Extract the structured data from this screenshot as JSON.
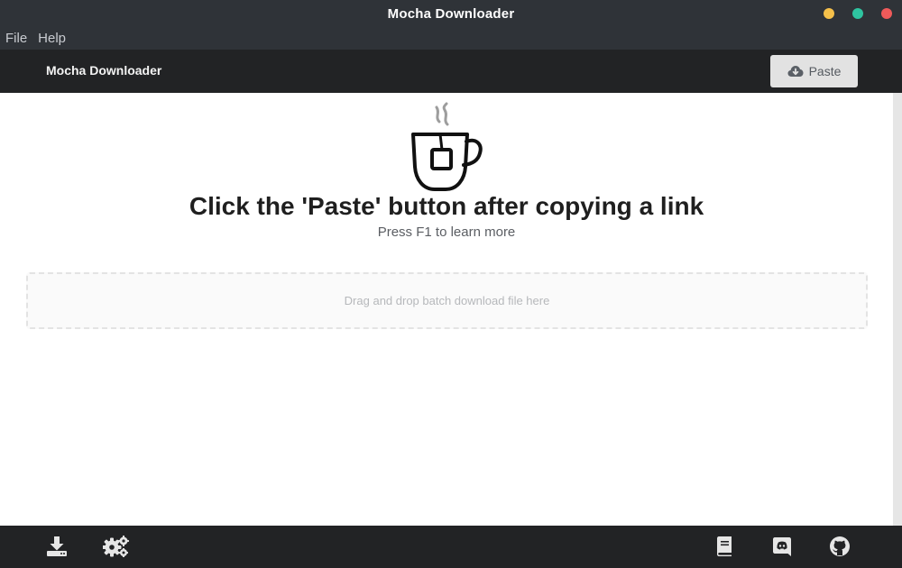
{
  "window": {
    "title": "Mocha Downloader",
    "controls": [
      "minimize",
      "maximize",
      "close"
    ]
  },
  "menu": {
    "items": [
      "File",
      "Help"
    ]
  },
  "header": {
    "app_name": "Mocha Downloader",
    "paste_label": "Paste",
    "paste_icon": "cloud-download-icon"
  },
  "main": {
    "illustration": "coffee-mug-icon",
    "headline": "Click the 'Paste' button after copying a link",
    "subline": "Press F1 to learn more",
    "dropzone_text": "Drag and drop batch download file here"
  },
  "footer": {
    "left_icons": [
      "downloads-icon",
      "settings-icon"
    ],
    "right_icons": [
      "docs-icon",
      "discord-icon",
      "github-icon"
    ]
  },
  "colors": {
    "titlebar": "#2f3338",
    "header": "#222325",
    "paste_button": "#e2e2e2",
    "minimize": "#f5c04a",
    "maximize": "#2ec4a0",
    "close": "#ef5a5a"
  }
}
